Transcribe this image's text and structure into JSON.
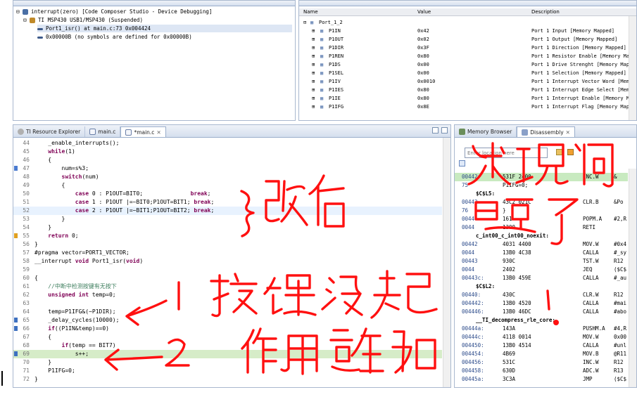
{
  "debug_view": {
    "rows": [
      {
        "text": "interrupt(zero) [Code Composer Studio - Device Debugging]",
        "icon": "debug-session-icon"
      },
      {
        "text": "TI MSP430 USB1/MSP430 (Suspended)",
        "icon": "thread-icon"
      },
      {
        "text": "Port1_isr() at main.c:73 0x004424",
        "icon": "stack-frame-icon"
      },
      {
        "text": "0x00000B  (no symbols are defined for 0x00000B)",
        "icon": "stack-frame-icon"
      }
    ]
  },
  "registers_view": {
    "columns": [
      "Name",
      "Value",
      "Description"
    ],
    "group": "Port_1_2",
    "rows": [
      {
        "name": "P1IN",
        "value": "0x42",
        "desc": "Port 1 Input [Memory Mapped]"
      },
      {
        "name": "P1OUT",
        "value": "0x02",
        "desc": "Port 1 Output [Memory Mapped]"
      },
      {
        "name": "P1DIR",
        "value": "0x3F",
        "desc": "Port 1 Direction [Memory Mapped]"
      },
      {
        "name": "P1REN",
        "value": "0x80",
        "desc": "Port 1 Resistor Enable [Memory Map"
      },
      {
        "name": "P1DS",
        "value": "0x00",
        "desc": "Port 1 Drive Strenght [Memory Mappe"
      },
      {
        "name": "P1SEL",
        "value": "0x00",
        "desc": "Port 1 Selection [Memory Mapped]"
      },
      {
        "name": "P1IV",
        "value": "0x0010",
        "desc": "Port 1 Interrupt Vector Word [Memo."
      },
      {
        "name": "P1IES",
        "value": "0x80",
        "desc": "Port 1 Interrupt Edge Select [Memo."
      },
      {
        "name": "P1IE",
        "value": "0x80",
        "desc": "Port 1 Interrupt Enable [Memory Ma."
      },
      {
        "name": "P1IFG",
        "value": "0x8E",
        "desc": "Port 1 Interrupt Flag [Memory Mappe"
      }
    ]
  },
  "editor": {
    "tabs": [
      "TI Resource Explorer",
      "main.c",
      "*main.c"
    ],
    "lines": [
      {
        "n": "44",
        "code": "    _enable_interrupts();"
      },
      {
        "n": "45",
        "code": "    while(1)"
      },
      {
        "n": "46",
        "code": "    {"
      },
      {
        "n": "47",
        "code": "        num=s%3;"
      },
      {
        "n": "48",
        "code": "        switch(num)"
      },
      {
        "n": "49",
        "code": "        {"
      },
      {
        "n": "50",
        "code": "            case 0 : P1OUT=BIT0;              break;"
      },
      {
        "n": "51",
        "code": "            case 1 : P1OUT |=~BIT0;P1OUT=BIT1; break;"
      },
      {
        "n": "52",
        "code": "            case 2 : P1OUT |=~BIT1;P1OUT=BIT2; break;"
      },
      {
        "n": "53",
        "code": "        }"
      },
      {
        "n": "54",
        "code": "    }"
      },
      {
        "n": "55",
        "code": "    return 0;"
      },
      {
        "n": "56",
        "code": "}"
      },
      {
        "n": "57",
        "code": "#pragma vector=PORT1_VECTOR;"
      },
      {
        "n": "58",
        "code": "__interrupt void Port1_isr(void)"
      },
      {
        "n": "59",
        "code": ""
      },
      {
        "n": "60",
        "code": "{"
      },
      {
        "n": "61",
        "code": "    //中断中检测按键有无按下"
      },
      {
        "n": "62",
        "code": "    unsigned int temp=0;"
      },
      {
        "n": "63",
        "code": ""
      },
      {
        "n": "64",
        "code": "    temp=P1IFG&(~P1DIR);"
      },
      {
        "n": "65",
        "code": "    _delay_cycles(10000);"
      },
      {
        "n": "66",
        "code": "    if((P1IN&temp)==0)"
      },
      {
        "n": "67",
        "code": "    {"
      },
      {
        "n": "68",
        "code": "        if(temp == BIT7)"
      },
      {
        "n": "69",
        "code": "            s++;"
      },
      {
        "n": "70",
        "code": "    }"
      },
      {
        "n": "71",
        "code": "    P1IFG=0;"
      },
      {
        "n": "72",
        "code": "}"
      }
    ]
  },
  "disassembly": {
    "tabs": [
      "Memory Browser",
      "Disassembly"
    ],
    "location_placeholder": "Enter location here",
    "rows": [
      {
        "addr": "00442",
        "hex": "531F 2400",
        "op": "INC.W",
        "arg": "&"
      },
      {
        "addr": "75",
        "hex": "P1IFG=0;",
        "op": "",
        "arg": ""
      },
      {
        "label": "$C$L5:"
      },
      {
        "addr": "00442",
        "hex": "43C2 021C",
        "op": "CLR.B",
        "arg": "&Po"
      },
      {
        "addr": "76",
        "hex": "}",
        "op": "",
        "arg": ""
      },
      {
        "addr": "0044",
        "hex": "161",
        "op": "POPM.A",
        "arg": "#2,R"
      },
      {
        "addr": "0044",
        "hex": "1300",
        "op": "RETI",
        "arg": ""
      },
      {
        "label": "c_int00_c_int00_noexit:"
      },
      {
        "addr": "00442",
        "hex": "4031 4400",
        "op": "MOV.W",
        "arg": "#0x4"
      },
      {
        "addr": "0044",
        "hex": "13B0 4C38",
        "op": "CALLA",
        "arg": "#_sy"
      },
      {
        "addr": "00443",
        "hex": "930C",
        "op": "TST.W",
        "arg": "R12"
      },
      {
        "addr": "0044",
        "hex": "2402",
        "op": "JEQ",
        "arg": "($C$"
      },
      {
        "addr": "00443c:",
        "hex": "13B0 459E",
        "op": "CALLA",
        "arg": "#_au"
      },
      {
        "label": "$C$L2:"
      },
      {
        "addr": "00440:",
        "hex": "430C",
        "op": "CLR.W",
        "arg": "R12"
      },
      {
        "addr": "004442:",
        "hex": "13B0 4520",
        "op": "CALLA",
        "arg": "#mai"
      },
      {
        "addr": "004446:",
        "hex": "13B0 46DC",
        "op": "CALLA",
        "arg": "#abo"
      },
      {
        "label": "__TI_decompress_rle_core:"
      },
      {
        "addr": "00444a:",
        "hex": "143A",
        "op": "PUSHM.A",
        "arg": "#4,R"
      },
      {
        "addr": "00444c:",
        "hex": "4118 0014",
        "op": "MOV.W",
        "arg": "0x00"
      },
      {
        "addr": "004450:",
        "hex": "13B0 4514",
        "op": "CALLA",
        "arg": "#unl"
      },
      {
        "addr": "004454:",
        "hex": "4B69",
        "op": "MOV.B",
        "arg": "@R11"
      },
      {
        "addr": "004456:",
        "hex": "531C",
        "op": "INC.W",
        "arg": "R12"
      },
      {
        "addr": "004458:",
        "hex": "630D",
        "op": "ADC.W",
        "arg": "R13"
      },
      {
        "addr": "00445a:",
        "hex": "3C3A",
        "op": "JMP",
        "arg": "($C$"
      }
    ]
  },
  "annotations": {
    "note_changed": "}改后",
    "note_found": "发现问题了",
    "label_1": "1",
    "label_2": "2",
    "note_key": "按键没起",
    "note_effect": "作用在加"
  }
}
